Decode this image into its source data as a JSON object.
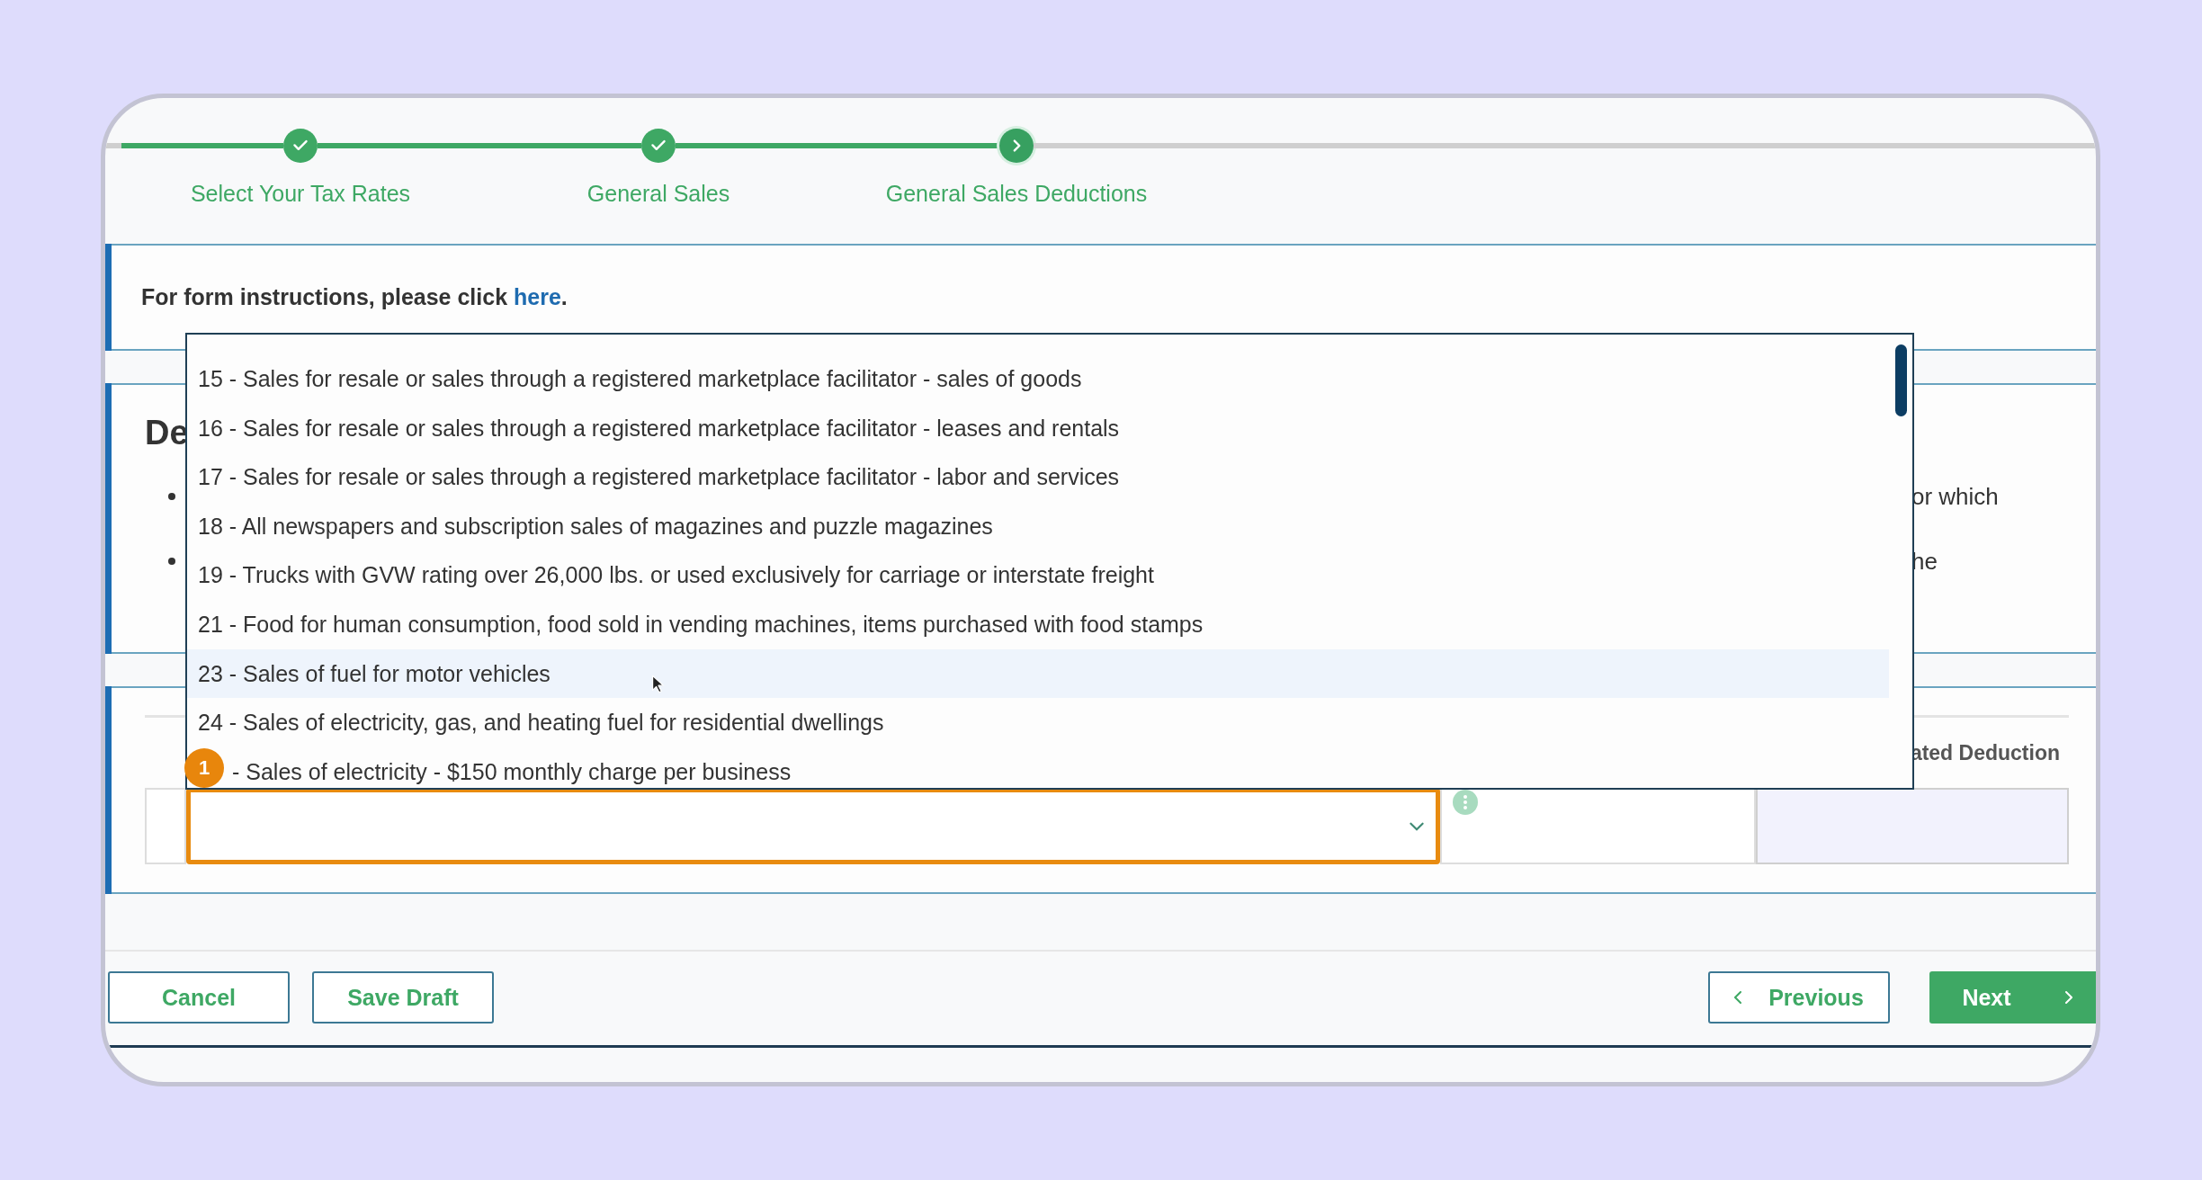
{
  "steps": [
    {
      "label": "Select Your Tax Rates",
      "completed": true,
      "current": false
    },
    {
      "label": "General Sales",
      "completed": true,
      "current": false
    },
    {
      "label": "General Sales Deductions",
      "completed": false,
      "current": true
    }
  ],
  "instructions": {
    "text": "For form instructions, please click",
    "link": "here",
    "suffix": "."
  },
  "section": {
    "heading": "De",
    "bullets": [
      {
        "text": "or which"
      },
      {
        "text": "he"
      }
    ]
  },
  "table": {
    "column_4_header": "ated Deduction",
    "rows": [
      {
        "highlighted": true
      }
    ]
  },
  "dropdown": {
    "options": [
      {
        "label": "15 - Sales for resale or sales through a registered marketplace facilitator - sales of goods",
        "hovered": false,
        "obscured": false
      },
      {
        "label": "16 - Sales for resale or sales through a registered marketplace facilitator - leases and rentals",
        "hovered": false,
        "obscured": false
      },
      {
        "label": "17 - Sales for resale or sales through a registered marketplace facilitator - labor and services",
        "hovered": false,
        "obscured": false
      },
      {
        "label": "18 - All newspapers and subscription sales of magazines and puzzle magazines",
        "hovered": false,
        "obscured": false
      },
      {
        "label": "19 - Trucks with GVW rating over 26,000 lbs. or used exclusively for carriage or interstate freight",
        "hovered": false,
        "obscured": false
      },
      {
        "label": "21 - Food for human consumption, food sold in vending machines, items purchased with food stamps",
        "hovered": false,
        "obscured": false
      },
      {
        "label": "23 - Sales of fuel for motor vehicles",
        "hovered": true,
        "obscured": false
      },
      {
        "label": "24 - Sales of electricity, gas, and heating fuel for residential dwellings",
        "hovered": false,
        "obscured": false
      },
      {
        "label": "- Sales of electricity - $150 monthly charge per business",
        "hovered": false,
        "obscured": true
      }
    ]
  },
  "tour_badge": {
    "label": "1"
  },
  "buttons": [
    {
      "label": "Cancel",
      "kind": "outline"
    },
    {
      "label": "Save Draft",
      "kind": "outline"
    },
    {
      "label": "Previous",
      "kind": "back"
    },
    {
      "label": "Next",
      "kind": "primary"
    }
  ]
}
